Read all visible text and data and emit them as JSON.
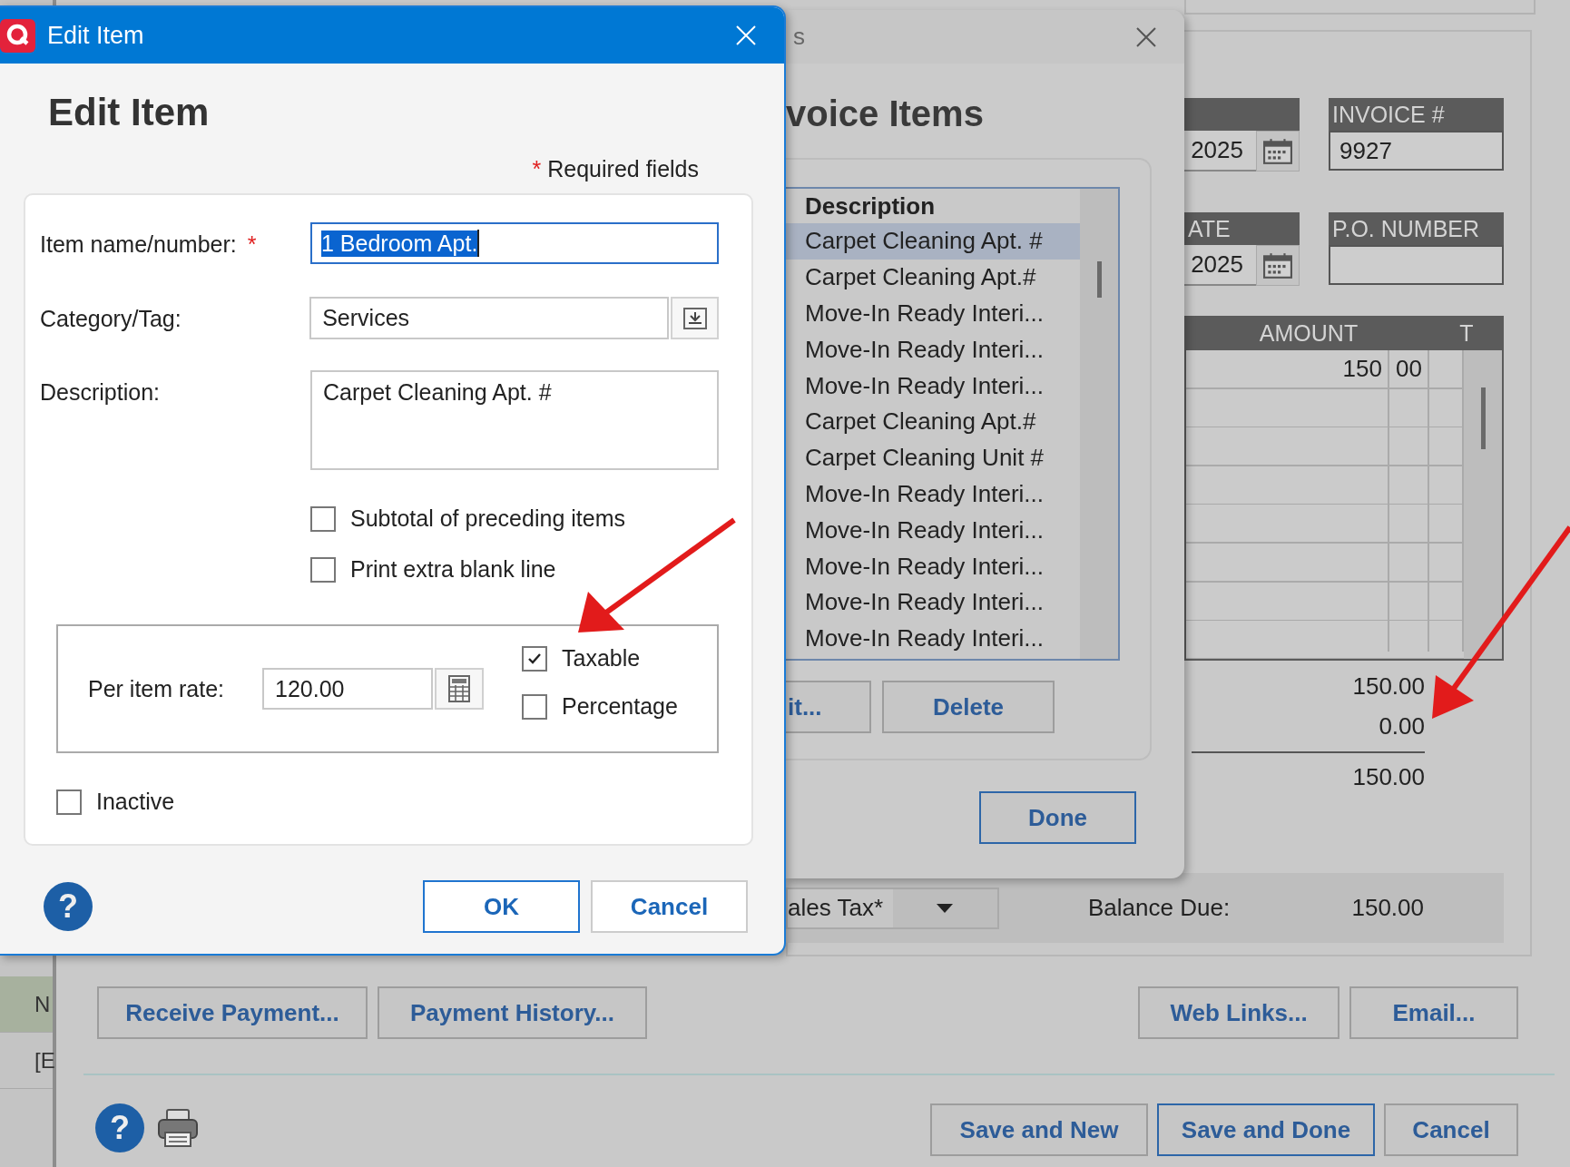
{
  "side_list": [
    {
      "text": "N",
      "selected": true
    },
    {
      "text": "[E",
      "selected": false
    }
  ],
  "invoice": {
    "date_fields": [
      {
        "value": "2025"
      },
      {
        "header": "ATE",
        "value": "2025"
      }
    ],
    "invoice_number": {
      "header": "INVOICE #",
      "value": "9927"
    },
    "po_number": {
      "header": "P.O. NUMBER"
    },
    "table": {
      "columns": [
        "AMOUNT",
        "T"
      ],
      "rows": [
        {
          "amount": "150",
          "cents": "00"
        }
      ]
    },
    "totals": [
      "150.00",
      "0.00",
      "150.00"
    ],
    "tax_dropdown": {
      "value": "ales Tax*"
    },
    "balance": {
      "label": "Balance Due:",
      "value": "150.00"
    },
    "left_buttons": [
      "Receive Payment...",
      "Payment History..."
    ],
    "right_buttons": [
      "Web Links...",
      "Email..."
    ],
    "help_button": "?",
    "footer_buttons": [
      {
        "label": "Save and New",
        "default": false
      },
      {
        "label": "Save and Done",
        "default": true
      },
      {
        "label": "Cancel",
        "default": false
      }
    ]
  },
  "invoice_items_dialog": {
    "title": "s",
    "heading": "voice Items",
    "list": {
      "column": "Description",
      "items": [
        {
          "text": "Carpet Cleaning Apt. #",
          "selected": true
        },
        {
          "text": "Carpet Cleaning Apt.#",
          "selected": false
        },
        {
          "text": "Move-In Ready Interi...",
          "selected": false
        },
        {
          "text": "Move-In Ready Interi...",
          "selected": false
        },
        {
          "text": "Move-In Ready Interi...",
          "selected": false
        },
        {
          "text": "Carpet Cleaning Apt.#",
          "selected": false
        },
        {
          "text": "Carpet Cleaning Unit #",
          "selected": false
        },
        {
          "text": "Move-In Ready Interi...",
          "selected": false
        },
        {
          "text": "Move-In Ready Interi...",
          "selected": false
        },
        {
          "text": "Move-In Ready Interi...",
          "selected": false
        },
        {
          "text": "Move-In Ready Interi...",
          "selected": false
        },
        {
          "text": "Move-In Ready Interi...",
          "selected": false
        }
      ]
    },
    "buttons": [
      "it...",
      "Delete"
    ],
    "done_button": "Done"
  },
  "edit_item_dialog": {
    "title": "Edit Item",
    "heading": "Edit Item",
    "required_note": {
      "mark": "*",
      "text": "Required fields"
    },
    "item_name": {
      "label": "Item name/number:",
      "required_mark": "*",
      "value": "1 Bedroom Apt.",
      "value_selected": true
    },
    "category": {
      "label": "Category/Tag:",
      "value": "Services"
    },
    "description": {
      "label": "Description:",
      "value": "Carpet Cleaning Apt. #"
    },
    "options": [
      {
        "label": "Subtotal of preceding items",
        "checked": false
      },
      {
        "label": "Print extra blank line",
        "checked": false
      }
    ],
    "rate": {
      "label": "Per item rate:",
      "value": "120.00"
    },
    "rate_options": [
      {
        "label": "Taxable",
        "checked": true
      },
      {
        "label": "Percentage",
        "checked": false
      }
    ],
    "inactive": {
      "label": "Inactive",
      "checked": false
    },
    "help_button": "?",
    "buttons": [
      {
        "label": "OK",
        "default": true
      },
      {
        "label": "Cancel",
        "default": false
      }
    ]
  }
}
